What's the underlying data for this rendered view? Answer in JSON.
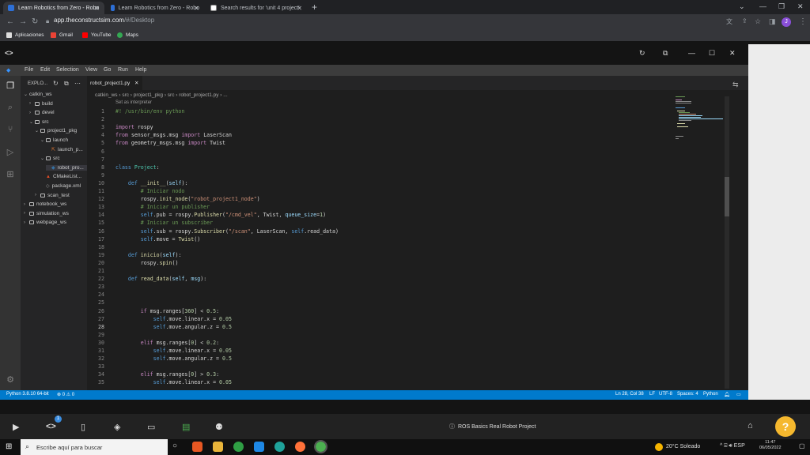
{
  "browser": {
    "tabs": [
      {
        "title": "Learn Robotics from Zero - Robo",
        "active": true
      },
      {
        "title": "Learn Robotics from Zero - Robo",
        "active": false
      },
      {
        "title": "Search results for 'unit 4 project'",
        "active": false
      }
    ],
    "url_host": "app.theconstructsim.com",
    "url_path": "/#/Desktop",
    "bookmarks": [
      "Aplicaciones",
      "Gmail",
      "YouTube",
      "Maps"
    ],
    "profile_initial": "J"
  },
  "vscode": {
    "menu": [
      "File",
      "Edit",
      "Selection",
      "View",
      "Go",
      "Run",
      "Help"
    ],
    "explorer_title": "EXPLO...",
    "tree": [
      {
        "label": "catkin_ws",
        "indent": 0,
        "chev": "v",
        "icon": "none"
      },
      {
        "label": "build",
        "indent": 1,
        "chev": ">",
        "icon": "folder"
      },
      {
        "label": "devel",
        "indent": 1,
        "chev": ">",
        "icon": "folder"
      },
      {
        "label": "src",
        "indent": 1,
        "chev": "v",
        "icon": "folder"
      },
      {
        "label": "project1_pkg",
        "indent": 2,
        "chev": "v",
        "icon": "folder"
      },
      {
        "label": "launch",
        "indent": 3,
        "chev": "v",
        "icon": "folder"
      },
      {
        "label": "launch_p...",
        "indent": 4,
        "chev": "",
        "icon": "file"
      },
      {
        "label": "src",
        "indent": 3,
        "chev": "v",
        "icon": "folder"
      },
      {
        "label": "robot_pro...",
        "indent": 4,
        "chev": "",
        "icon": "py",
        "selected": true
      },
      {
        "label": "CMakeList...",
        "indent": 3,
        "chev": "",
        "icon": "cmake"
      },
      {
        "label": "package.xml",
        "indent": 3,
        "chev": "",
        "icon": "xml"
      },
      {
        "label": "scan_test",
        "indent": 2,
        "chev": ">",
        "icon": "folder"
      },
      {
        "label": "notebook_ws",
        "indent": 0,
        "chev": ">",
        "icon": "folder"
      },
      {
        "label": "simulation_ws",
        "indent": 0,
        "chev": ">",
        "icon": "folder"
      },
      {
        "label": "webpage_ws",
        "indent": 0,
        "chev": ">",
        "icon": "folder"
      }
    ],
    "open_tab": "robot_project1.py",
    "breadcrumb": [
      "catkin_ws",
      "src",
      "project1_pkg",
      "src",
      "robot_project1.py",
      "..."
    ],
    "set_interpreter": "Set as interpreter",
    "code_lines": [
      {
        "n": "1",
        "html": "<span class='cm'>#! /usr/bin/env python</span>"
      },
      {
        "n": "2",
        "html": ""
      },
      {
        "n": "3",
        "html": "<span class='kw2'>import</span> rospy"
      },
      {
        "n": "4",
        "html": "<span class='kw2'>from</span> sensor_msgs.msg <span class='kw2'>import</span> LaserScan"
      },
      {
        "n": "5",
        "html": "<span class='kw2'>from</span> geometry_msgs.msg <span class='kw2'>import</span> Twist"
      },
      {
        "n": "6",
        "html": ""
      },
      {
        "n": "7",
        "html": ""
      },
      {
        "n": "8",
        "html": "<span class='kw'>class</span> <span class='cls'>Project</span>:"
      },
      {
        "n": "9",
        "html": ""
      },
      {
        "n": "10",
        "html": "    <span class='kw'>def</span> <span class='fn'>__init__</span>(<span class='param'>self</span>):"
      },
      {
        "n": "11",
        "html": "        <span class='cm'># Iniciar nodo</span>"
      },
      {
        "n": "12",
        "html": "        rospy.<span class='fn'>init_node</span>(<span class='str'>\"robot_project1_node\"</span>)"
      },
      {
        "n": "13",
        "html": "        <span class='cm'># Iniciar un publisher</span>"
      },
      {
        "n": "14",
        "html": "        <span class='self'>self</span>.pub = rospy.<span class='fn'>Publisher</span>(<span class='str'>\"/cmd_vel\"</span>, Twist, <span class='param'>queue_size</span>=<span class='num'>1</span>)"
      },
      {
        "n": "15",
        "html": "        <span class='cm'># Iniciar un subscriber</span>"
      },
      {
        "n": "16",
        "html": "        <span class='self'>self</span>.sub = rospy.<span class='fn'>Subscriber</span>(<span class='str'>\"/scan\"</span>, LaserScan, <span class='self'>self</span>.read_data)"
      },
      {
        "n": "17",
        "html": "        <span class='self'>self</span>.move = <span class='fn'>Twist</span>()"
      },
      {
        "n": "18",
        "html": ""
      },
      {
        "n": "19",
        "html": "    <span class='kw'>def</span> <span class='fn'>inicio</span>(<span class='param'>self</span>):"
      },
      {
        "n": "20",
        "html": "        rospy.<span class='fn'>spin</span>()"
      },
      {
        "n": "21",
        "html": ""
      },
      {
        "n": "22",
        "html": "    <span class='kw'>def</span> <span class='fn'>read_data</span>(<span class='param'>self</span>, <span class='param'>msg</span>):"
      },
      {
        "n": "23",
        "html": ""
      },
      {
        "n": "24",
        "html": ""
      },
      {
        "n": "25",
        "html": ""
      },
      {
        "n": "26",
        "html": "        <span class='kw2'>if</span> msg.ranges[<span class='num'>360</span>] &lt; <span class='num'>0.5</span>:"
      },
      {
        "n": "27",
        "html": "            <span class='self'>self</span>.move.linear.x = <span class='num'>0.05</span>"
      },
      {
        "n": "28",
        "html": "            <span class='self'>self</span>.move.angular.z = <span class='num'>0.5</span>"
      },
      {
        "n": "29",
        "html": ""
      },
      {
        "n": "30",
        "html": "        <span class='kw2'>elif</span> msg.ranges[<span class='num'>0</span>] &lt; <span class='num'>0.2</span>:"
      },
      {
        "n": "31",
        "html": "            <span class='self'>self</span>.move.linear.x = <span class='num'>0.05</span>"
      },
      {
        "n": "32",
        "html": "            <span class='self'>self</span>.move.angular.z = <span class='num'>0.5</span>"
      },
      {
        "n": "33",
        "html": ""
      },
      {
        "n": "34",
        "html": "        <span class='kw2'>elif</span> msg.ranges[<span class='num'>0</span>] &gt; <span class='num'>0.3</span>:"
      },
      {
        "n": "35",
        "html": "            <span class='self'>self</span>.move.linear.x = <span class='num'>0.05</span>"
      }
    ],
    "status": {
      "python": "Python 3.8.10 64-bit",
      "problems": "⊗ 0 ⚠ 0",
      "position": "Ln 28, Col 38",
      "eol": "LF",
      "encoding": "UTF-8",
      "spaces": "Spaces: 4",
      "lang": "Python"
    }
  },
  "appbar": {
    "project_title": "ROS Basics Real Robot Project",
    "badge": "1",
    "help": "?"
  },
  "taskbar": {
    "search_placeholder": "Escribe aquí para buscar",
    "weather": "20°C  Soleado",
    "time": "11:47",
    "date": "06/05/2022"
  }
}
